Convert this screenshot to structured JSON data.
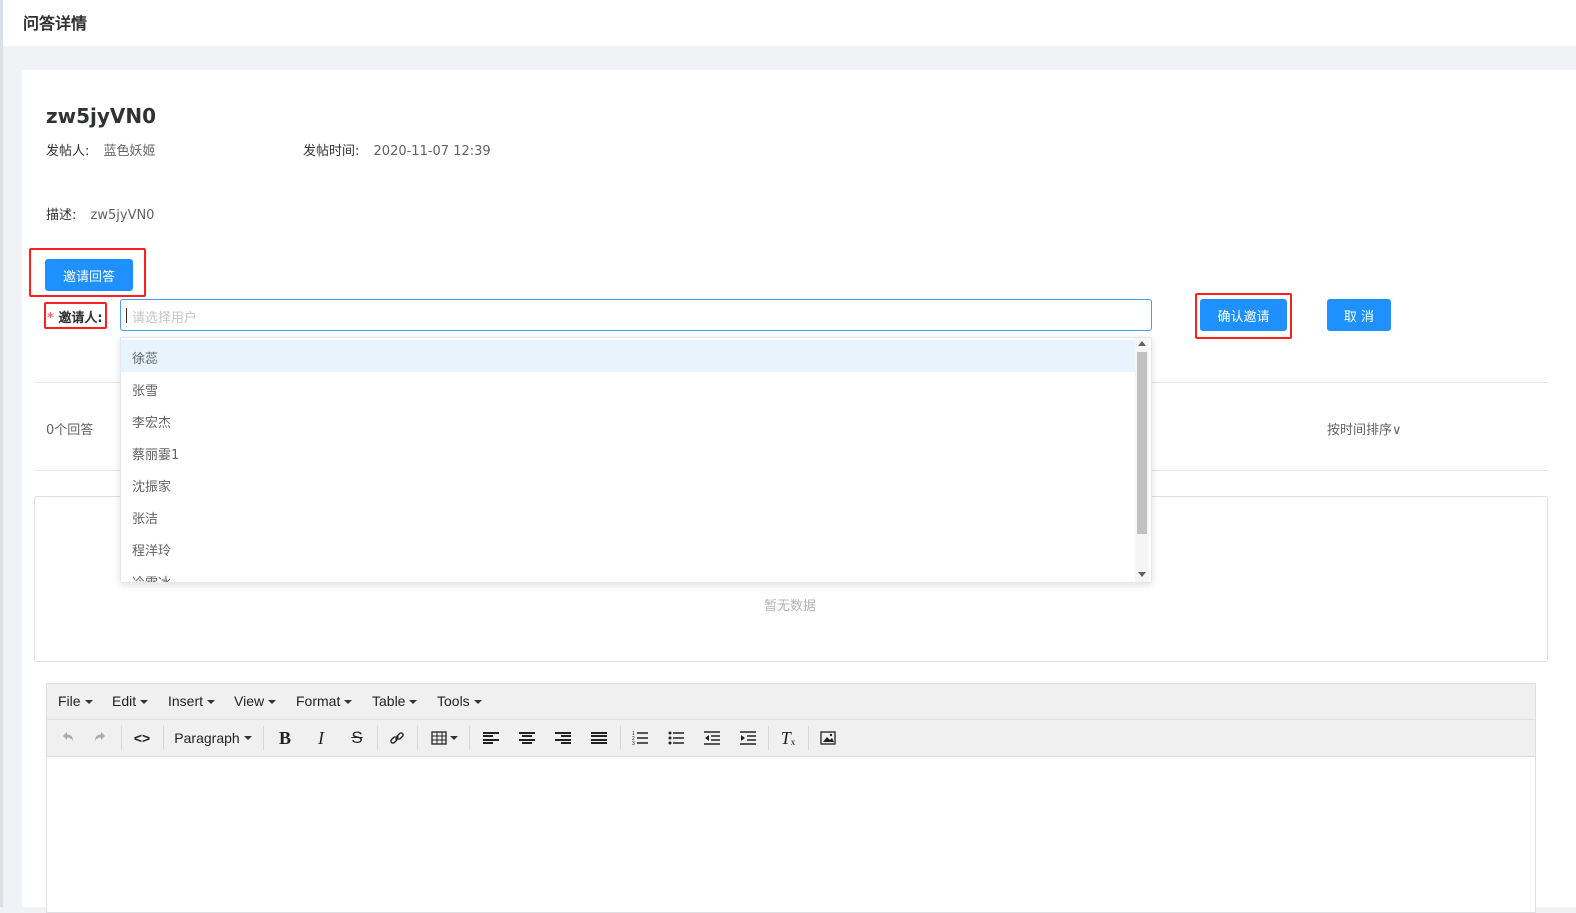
{
  "page": {
    "title": "问答详情"
  },
  "post": {
    "title": "zw5jyVN0",
    "author_label": "发帖人:",
    "author": "蓝色妖姬",
    "time_label": "发帖时间:",
    "time": "2020-11-07 12:39",
    "desc_label": "描述:",
    "desc": "zw5jyVN0"
  },
  "invite": {
    "invite_button": "邀请回答",
    "required_mark": "*",
    "invitee_label": "邀请人:",
    "select_placeholder": "请选择用户",
    "confirm_button": "确认邀请",
    "cancel_button": "取 消",
    "options": [
      "徐蕊",
      "张雪",
      "李宏杰",
      "蔡丽霎1",
      "沈振家",
      "张洁",
      "程洋玲",
      "冷雪冰"
    ],
    "highlighted_option": "徐蕊"
  },
  "answers": {
    "count": "0个回答",
    "sort": "按时间排序∨",
    "empty": "暂无数据"
  },
  "editor": {
    "menus": [
      "File",
      "Edit",
      "Insert",
      "View",
      "Format",
      "Table",
      "Tools"
    ],
    "block_format": "Paragraph",
    "icons": [
      "undo-icon",
      "redo-icon",
      "code-icon",
      "bold-icon",
      "italic-icon",
      "strikethrough-icon",
      "link-icon",
      "table-icon",
      "align-left-icon",
      "align-center-icon",
      "align-right-icon",
      "align-justify-icon",
      "numbered-list-icon",
      "bullet-list-icon",
      "outdent-icon",
      "indent-icon",
      "clear-format-icon",
      "image-icon"
    ]
  },
  "colors": {
    "primary": "#1e90ff",
    "highlight_border": "#ff1f1f",
    "option_highlight": "#e8f4fd"
  }
}
